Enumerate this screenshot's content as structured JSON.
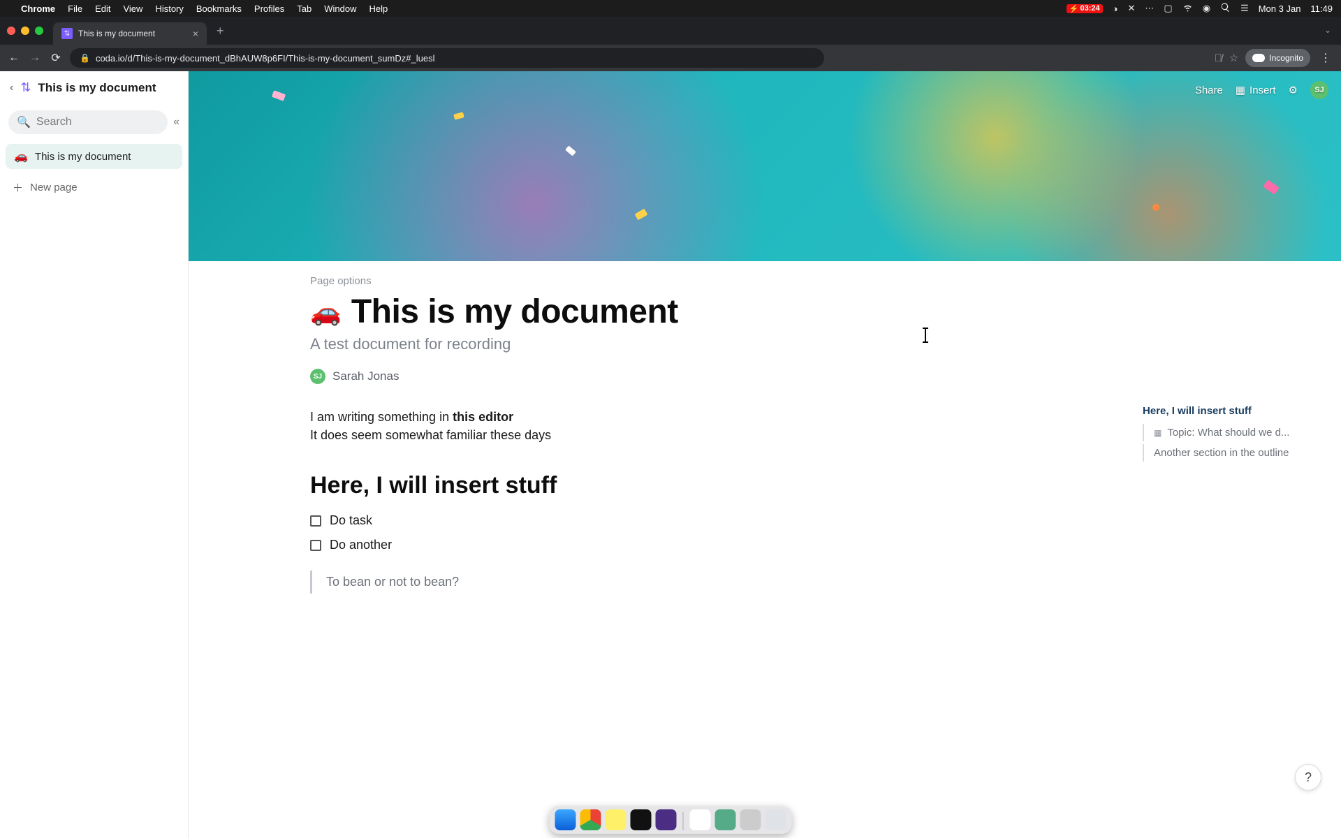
{
  "menubar": {
    "app": "Chrome",
    "items": [
      "File",
      "Edit",
      "View",
      "History",
      "Bookmarks",
      "Profiles",
      "Tab",
      "Window",
      "Help"
    ],
    "battery_time": "03:24",
    "date": "Mon 3 Jan",
    "time": "11:49"
  },
  "chrome": {
    "tab_title": "This is my document",
    "url": "coda.io/d/This-is-my-document_dBhAUW8p6FI/This-is-my-document_sumDz#_luesl",
    "incognito": "Incognito"
  },
  "sidebar": {
    "doc_title": "This is my document",
    "search_placeholder": "Search",
    "pages": [
      {
        "emoji": "🚗",
        "label": "This is my document",
        "active": true
      }
    ],
    "new_page": "New page"
  },
  "header": {
    "share": "Share",
    "insert": "Insert",
    "avatar_initials": "SJ"
  },
  "doc": {
    "page_options": "Page options",
    "emoji": "🚗",
    "title": "This is my document",
    "subtitle": "A test document for recording",
    "author_initials": "SJ",
    "author_name": "Sarah Jonas",
    "p1_a": "I am writing something in ",
    "p1_b": "this editor",
    "p2": "It does seem somewhat familiar these days",
    "h2": "Here, I will insert stuff",
    "tasks": [
      "Do task",
      "Do another"
    ],
    "quote": "To bean or not to bean?"
  },
  "outline": {
    "h1": "Here, I will insert stuff",
    "items": [
      {
        "icon": "grid",
        "label": "Topic: What should we d..."
      },
      {
        "icon": "",
        "label": "Another section in the outline"
      }
    ]
  },
  "help": "?"
}
